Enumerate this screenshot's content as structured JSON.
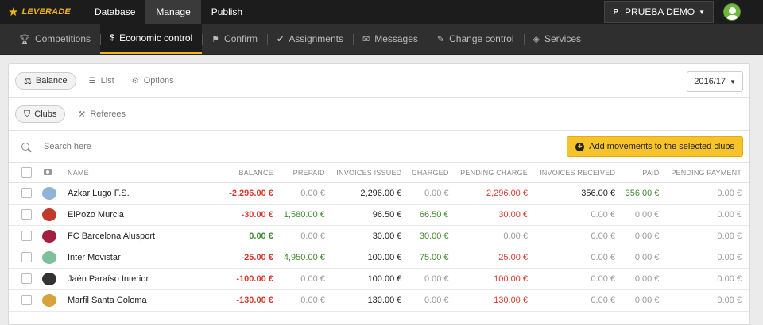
{
  "topbar": {
    "brand": "LEVERADE",
    "nav": [
      {
        "label": "Database"
      },
      {
        "label": "Manage"
      },
      {
        "label": "Publish"
      }
    ],
    "account_initial": "P",
    "account_name": "PRUEBA DEMO"
  },
  "subnav": [
    {
      "label": "Competitions",
      "icon": "trophy-icon"
    },
    {
      "label": "Economic control",
      "icon": "dollar-icon"
    },
    {
      "label": "Confirm",
      "icon": "flag-icon"
    },
    {
      "label": "Assignments",
      "icon": "check-icon"
    },
    {
      "label": "Messages",
      "icon": "envelope-icon"
    },
    {
      "label": "Change control",
      "icon": "edit-icon"
    },
    {
      "label": "Services",
      "icon": "cube-icon"
    }
  ],
  "toolbar": {
    "balance": "Balance",
    "list": "List",
    "options": "Options",
    "season": "2016/17"
  },
  "filter": {
    "clubs": "Clubs",
    "referees": "Referees"
  },
  "search": {
    "placeholder": "Search here",
    "add_button": "Add movements to the selected clubs"
  },
  "table": {
    "columns": {
      "name": "NAME",
      "balance": "BALANCE",
      "prepaid": "PREPAID",
      "invoices_issued": "INVOICES ISSUED",
      "charged": "CHARGED",
      "pending_charge": "PENDING CHARGE",
      "invoices_received": "INVOICES RECEIVED",
      "paid": "PAID",
      "pending_payment": "PENDING PAYMENT"
    },
    "rows": [
      {
        "name": "Azkar Lugo F.S.",
        "balance": "-2,296.00 €",
        "prepaid": "0.00 €",
        "invoices_issued": "2,296.00 €",
        "charged": "0.00 €",
        "pending_charge": "2,296.00 €",
        "invoices_received": "356.00 €",
        "paid": "356.00 €",
        "pending_payment": "0.00 €"
      },
      {
        "name": "ElPozo Murcia",
        "balance": "-30.00 €",
        "prepaid": "1,580.00 €",
        "invoices_issued": "96.50 €",
        "charged": "66.50 €",
        "pending_charge": "30.00 €",
        "invoices_received": "0.00 €",
        "paid": "0.00 €",
        "pending_payment": "0.00 €"
      },
      {
        "name": "FC Barcelona Alusport",
        "balance": "0.00 €",
        "prepaid": "0.00 €",
        "invoices_issued": "30.00 €",
        "charged": "30.00 €",
        "pending_charge": "0.00 €",
        "invoices_received": "0.00 €",
        "paid": "0.00 €",
        "pending_payment": "0.00 €"
      },
      {
        "name": "Inter Movistar",
        "balance": "-25.00 €",
        "prepaid": "4,950.00 €",
        "invoices_issued": "100.00 €",
        "charged": "75.00 €",
        "pending_charge": "25.00 €",
        "invoices_received": "0.00 €",
        "paid": "0.00 €",
        "pending_payment": "0.00 €"
      },
      {
        "name": "Jaén Paraíso Interior",
        "balance": "-100.00 €",
        "prepaid": "0.00 €",
        "invoices_issued": "100.00 €",
        "charged": "0.00 €",
        "pending_charge": "100.00 €",
        "invoices_received": "0.00 €",
        "paid": "0.00 €",
        "pending_payment": "0.00 €"
      },
      {
        "name": "Marfil Santa Coloma",
        "balance": "-130.00 €",
        "prepaid": "0.00 €",
        "invoices_issued": "130.00 €",
        "charged": "0.00 €",
        "pending_charge": "130.00 €",
        "invoices_received": "0.00 €",
        "paid": "0.00 €",
        "pending_payment": "0.00 €"
      }
    ]
  },
  "colors": {
    "accent": "#f2b51d",
    "negative": "#d43a2f",
    "positive": "#3f8a2f",
    "zero": "#9a9a9a",
    "crests": [
      "#8fb3d9",
      "#c0392b",
      "#a31f3f",
      "#7fbf9a",
      "#333333",
      "#d8a23a"
    ]
  }
}
